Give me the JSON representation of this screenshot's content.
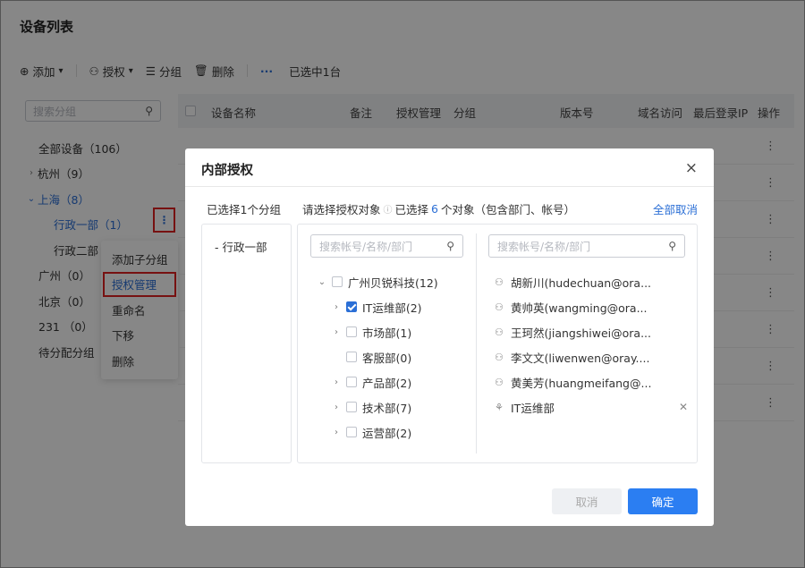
{
  "page": {
    "title": "设备列表"
  },
  "toolbar": {
    "add_label": "添加",
    "auth_label": "授权",
    "group_label": "分组",
    "delete_label": "删除",
    "more_label": "···",
    "status": "已选中1台"
  },
  "sidebar": {
    "search_placeholder": "搜索分组",
    "items": [
      {
        "label": "全部设备（106）",
        "arrow": ""
      },
      {
        "label": "杭州（9）",
        "arrow": "›"
      },
      {
        "label": "上海（8）",
        "arrow": "⌄"
      },
      {
        "label": "行政一部（1）",
        "arrow": ""
      },
      {
        "label": "行政二部",
        "arrow": ""
      },
      {
        "label": "广州（0）",
        "arrow": ""
      },
      {
        "label": "北京（0）",
        "arrow": ""
      },
      {
        "label": "231 （0）",
        "arrow": ""
      },
      {
        "label": "待分配分组",
        "arrow": ""
      }
    ],
    "kebab": "⋮"
  },
  "context_menu": {
    "items": [
      "添加子分组",
      "授权管理",
      "重命名",
      "下移",
      "删除"
    ]
  },
  "table": {
    "headers": [
      "设备名称",
      "备注",
      "授权管理",
      "分组",
      "版本号",
      "域名访问",
      "最后登录IP",
      "操作"
    ],
    "row_kebab": "⋮"
  },
  "modal": {
    "title": "内部授权",
    "close": "×",
    "left_label": "已选择1个分组",
    "mid_label_prefix": "请选择授权对象",
    "mid_label_selected": "已选择",
    "mid_label_count": "6",
    "mid_label_suffix": "个对象（包含部门、帐号）",
    "clear_all": "全部取消",
    "selected_group": "-  行政一部",
    "search_placeholder": "搜索帐号/名称/部门",
    "org_tree": [
      {
        "label": "广州贝锐科技(12)",
        "arrow": "⌄",
        "checked": false,
        "level": 0
      },
      {
        "label": "IT运维部(2)",
        "arrow": "›",
        "checked": true,
        "level": 1
      },
      {
        "label": "市场部(1)",
        "arrow": "›",
        "checked": false,
        "level": 1
      },
      {
        "label": "客服部(0)",
        "arrow": "",
        "checked": false,
        "level": 1
      },
      {
        "label": "产品部(2)",
        "arrow": "›",
        "checked": false,
        "level": 1
      },
      {
        "label": "技术部(7)",
        "arrow": "›",
        "checked": false,
        "level": 1
      },
      {
        "label": "运营部(2)",
        "arrow": "›",
        "checked": false,
        "level": 1
      }
    ],
    "selected_list": [
      {
        "label": "胡新川(hudechuan@ora...",
        "icon": "user-icon"
      },
      {
        "label": "黄帅英(wangming@ora...",
        "icon": "user-icon"
      },
      {
        "label": "王珂然(jiangshiwei@ora...",
        "icon": "user-icon"
      },
      {
        "label": "李文文(liwenwen@oray....",
        "icon": "user-icon"
      },
      {
        "label": "黄美芳(huangmeifang@...",
        "icon": "user-icon"
      },
      {
        "label": "IT运维部",
        "icon": "department-icon",
        "removable": true
      }
    ],
    "cancel_label": "取消",
    "ok_label": "确定"
  }
}
